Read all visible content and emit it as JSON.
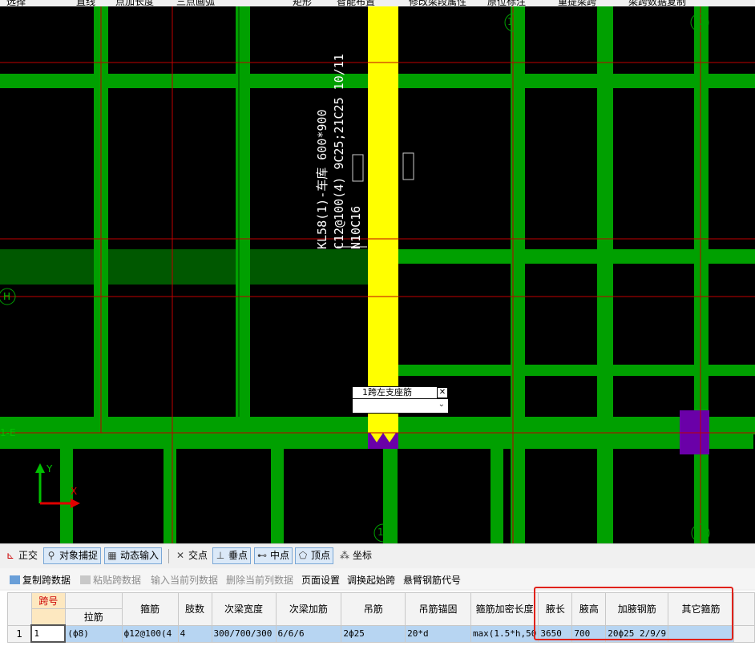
{
  "toolbar": {
    "items": [
      "选择",
      "直线",
      "点加长度",
      "三点画弧",
      "矩形",
      "智能布置",
      "修改梁段属性",
      "原位标注",
      "重提梁跨",
      "梁跨数据复制"
    ]
  },
  "canvas": {
    "beam_label_lines": [
      "KL58(1)-车库 600*900",
      "C12@100(4) 9C25;21C25 10/11",
      "N10C16"
    ],
    "axis_labels": {
      "a12": "12",
      "a13_top": "13",
      "a11": "11",
      "a13_bottom": "13",
      "aH": "H",
      "a1E": "1-E"
    },
    "axes": {
      "x": "X",
      "y": "Y"
    },
    "colors": {
      "beam_green": "#00a000",
      "dark_green": "#005800",
      "yellow": "#ffff00",
      "purple": "#6a00a8",
      "grid_red": "#c00000"
    },
    "popup": {
      "title": "1跨左支座筋",
      "value": ""
    }
  },
  "snap_bar": {
    "items": [
      "正交",
      "对象捕捉",
      "动态输入",
      "交点",
      "垂点",
      "中点",
      "顶点",
      "坐标"
    ]
  },
  "edit_bar": {
    "items": [
      "复制跨数据",
      "粘贴跨数据",
      "输入当前列数据",
      "删除当前列数据",
      "页面设置",
      "调换起始跨",
      "悬臂钢筋代号"
    ]
  },
  "table": {
    "header_top": [
      "跨号",
      "箍筋",
      "肢数",
      "次梁宽度",
      "次梁加筋",
      "吊筋",
      "吊筋锚固",
      "箍筋加密长度",
      "腋长",
      "腋高",
      "加腋钢筋",
      "其它箍筋"
    ],
    "header_sub": "拉筋",
    "row": {
      "num": "1",
      "span": "1",
      "tie": "(ф8)",
      "stirrup": "ф12@100(4",
      "legs": "4",
      "sec_width": "300/700/300",
      "sec_add": "6/6/6",
      "hanger": "2ф25",
      "hanger_anchor": "20*d",
      "dense_len": "max(1.5*h,50",
      "haunch_len": "3650",
      "haunch_h": "700",
      "haunch_bar": "20ф25 2/9/9",
      "other": ""
    }
  }
}
